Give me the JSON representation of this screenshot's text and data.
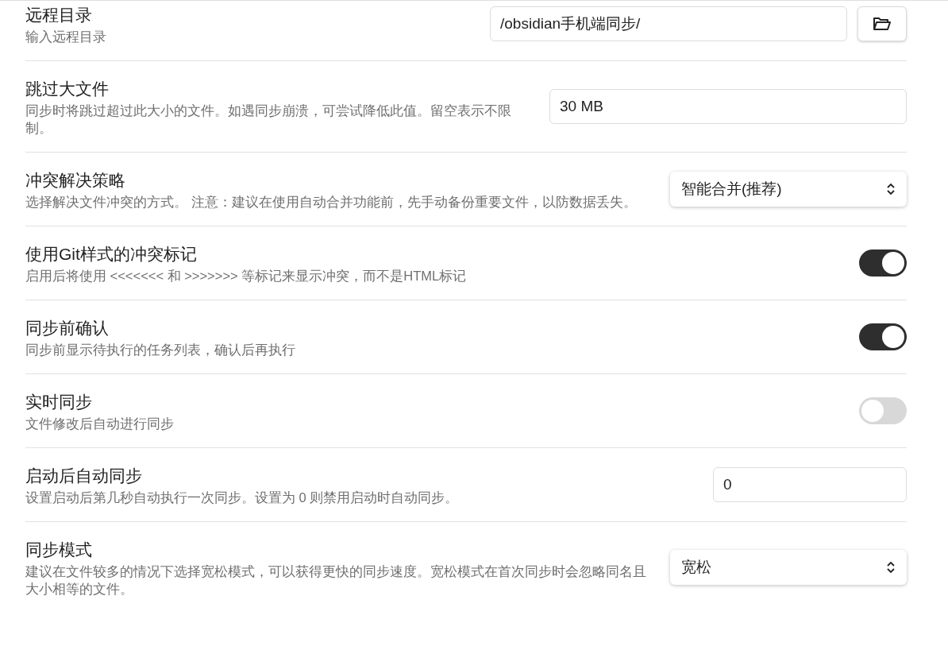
{
  "settings": [
    {
      "kind": "path",
      "title": "远程目录",
      "description": "输入远程目录",
      "value": "/obsidian手机端同步/"
    },
    {
      "kind": "input",
      "title": "跳过大文件",
      "description": "同步时将跳过超过此大小的文件。如遇同步崩溃，可尝试降低此值。留空表示不限制。",
      "value": "30 MB"
    },
    {
      "kind": "select",
      "title": "冲突解决策略",
      "description": "选择解决文件冲突的方式。 注意：建议在使用自动合并功能前，先手动备份重要文件，以防数据丢失。",
      "value": "智能合并(推荐)"
    },
    {
      "kind": "toggle",
      "title": "使用Git样式的冲突标记",
      "description": "启用后将使用 <<<<<<< 和 >>>>>>> 等标记来显示冲突，而不是HTML标记",
      "on": true
    },
    {
      "kind": "toggle",
      "title": "同步前确认",
      "description": "同步前显示待执行的任务列表，确认后再执行",
      "on": true
    },
    {
      "kind": "toggle",
      "title": "实时同步",
      "description": "文件修改后自动进行同步",
      "on": false
    },
    {
      "kind": "number",
      "title": "启动后自动同步",
      "description": "设置启动后第几秒自动执行一次同步。设置为 0 则禁用启动时自动同步。",
      "value": "0"
    },
    {
      "kind": "select",
      "title": "同步模式",
      "description": "建议在文件较多的情况下选择宽松模式，可以获得更快的同步速度。宽松模式在首次同步时会忽略同名且大小相等的文件。",
      "value": "宽松"
    }
  ]
}
